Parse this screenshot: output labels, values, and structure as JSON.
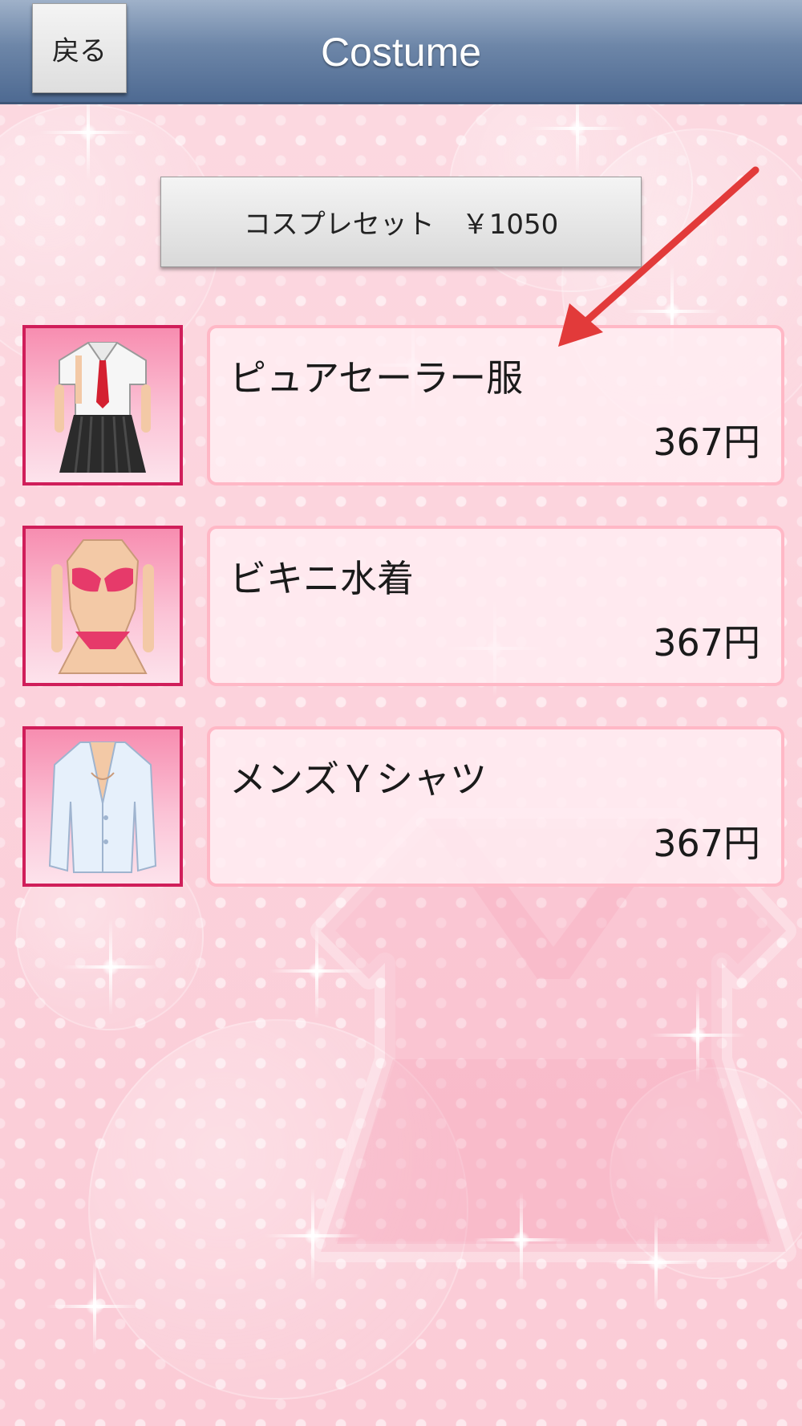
{
  "header": {
    "back_label": "戻る",
    "title": "Costume"
  },
  "cosplay_set": {
    "label": "コスプレセット　￥1050"
  },
  "costumes": [
    {
      "name": "ピュアセーラー服",
      "price": "367円",
      "icon": "sailor-uniform-icon"
    },
    {
      "name": "ビキニ水着",
      "price": "367円",
      "icon": "bikini-icon"
    },
    {
      "name": "メンズＹシャツ",
      "price": "367円",
      "icon": "mens-shirt-icon"
    }
  ],
  "colors": {
    "header": "#5c7699",
    "background": "#fbd0da",
    "thumb_border": "#d01e5a",
    "card_border": "#ffb8c6",
    "annotation_arrow": "#e23a3a"
  }
}
